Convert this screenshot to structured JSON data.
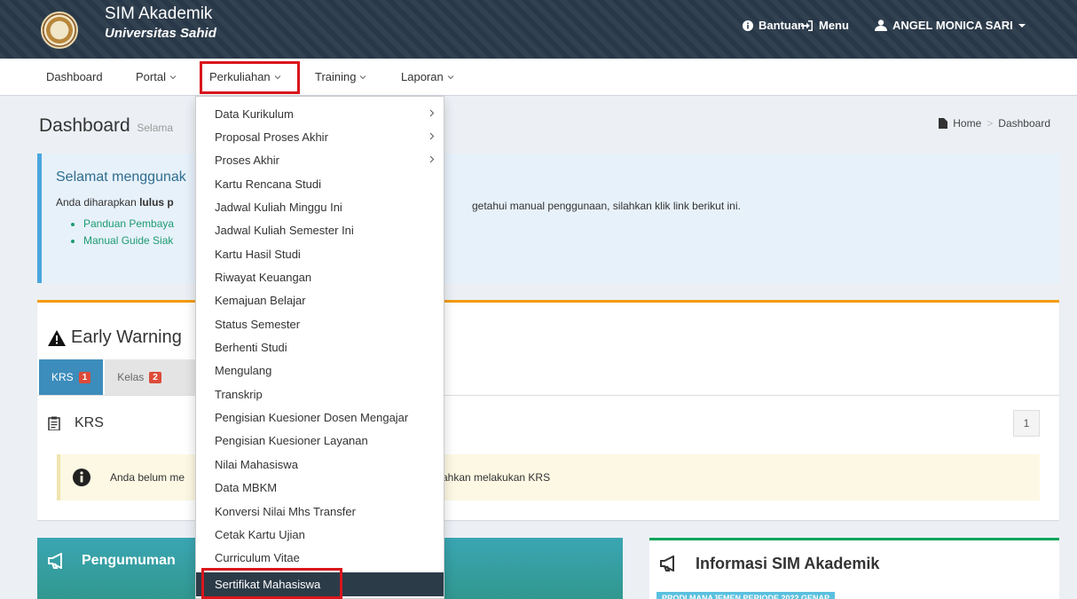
{
  "header": {
    "app_title": "SIM Akademik",
    "app_subtitle": "Universitas Sahid",
    "help_label": "Bantuan",
    "menu_label": "Menu",
    "user_name": "ANGEL MONICA SARI"
  },
  "menubar": {
    "items": [
      {
        "label": "Dashboard"
      },
      {
        "label": "Portal"
      },
      {
        "label": "Perkuliahan"
      },
      {
        "label": "Training"
      },
      {
        "label": "Laporan"
      }
    ]
  },
  "dropdown": {
    "items": [
      {
        "label": "Data Kurikulum",
        "submenu": true
      },
      {
        "label": "Proposal Proses Akhir",
        "submenu": true
      },
      {
        "label": "Proses Akhir",
        "submenu": true
      },
      {
        "label": "Kartu Rencana Studi"
      },
      {
        "label": "Jadwal Kuliah Minggu Ini"
      },
      {
        "label": "Jadwal Kuliah Semester Ini"
      },
      {
        "label": "Kartu Hasil Studi"
      },
      {
        "label": "Riwayat Keuangan"
      },
      {
        "label": "Kemajuan Belajar"
      },
      {
        "label": "Status Semester"
      },
      {
        "label": "Berhenti Studi"
      },
      {
        "label": "Mengulang"
      },
      {
        "label": "Transkrip"
      },
      {
        "label": "Pengisian Kuesioner Dosen Mengajar"
      },
      {
        "label": "Pengisian Kuesioner Layanan"
      },
      {
        "label": "Nilai Mahasiswa"
      },
      {
        "label": "Data MBKM"
      },
      {
        "label": "Konversi Nilai Mhs Transfer"
      },
      {
        "label": "Cetak Kartu Ujian"
      },
      {
        "label": "Curriculum Vitae"
      },
      {
        "label": "Sertifikat Mahasiswa",
        "active": true
      }
    ]
  },
  "content": {
    "page_title": "Dashboard",
    "page_subtitle": "Selama",
    "breadcrumb": {
      "home": "Home",
      "current": "Dashboard"
    },
    "callout": {
      "heading": "Selamat menggunak",
      "text_plain": "Anda diharapkan ",
      "text_bold": "lulus p",
      "text_hint": "getahui manual penggunaan, silahkan klik link berikut ini.",
      "links": [
        "Panduan Pembaya",
        "Manual Guide Siak"
      ]
    },
    "early_warning": {
      "title": "Early Warning",
      "tabs": [
        {
          "label": "KRS",
          "badge": "1"
        },
        {
          "label": "Kelas",
          "badge": "2"
        }
      ],
      "section_title": "KRS",
      "count": "1",
      "warning_text_1": "Anda belum me",
      "warning_text_2": "ahkan melakukan KRS"
    },
    "announcement": {
      "title": "Pengumuman"
    },
    "info": {
      "title": "Informasi SIM Akademik",
      "label": "PRODI MANAJEMEN PERIODE 2022 GENAP"
    }
  },
  "colors": {
    "header_bg": "#2a3a4a",
    "highlight_red": "#d9161c",
    "active_tab": "#3c8dbc",
    "warning_border": "#f39c12",
    "link_green": "#1d9b72"
  }
}
